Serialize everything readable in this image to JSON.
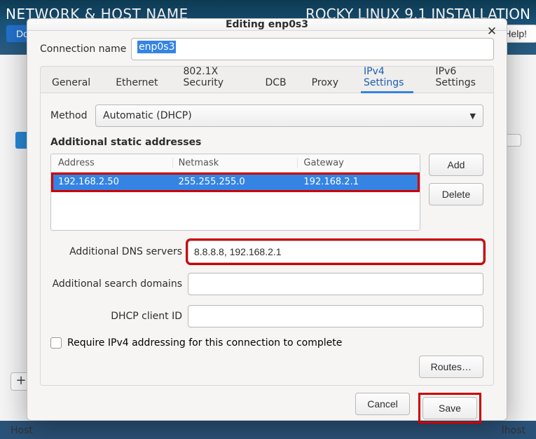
{
  "window": {
    "page_title": "NETWORK & HOST NAME",
    "installer_banner": "ROCKY LINUX 9.1 INSTALLATION",
    "done_btn": "Done",
    "help_btn": "Help!"
  },
  "background": {
    "hostname_label": "Host",
    "hostname_value": "lhost",
    "add_btn": "+"
  },
  "dialog": {
    "title": "Editing enp0s3",
    "close_glyph": "✕",
    "connection_name_label": "Connection name",
    "connection_name_value": "enp0s3",
    "tabs": {
      "general": "General",
      "ethernet": "Ethernet",
      "security": "802.1X Security",
      "dcb": "DCB",
      "proxy": "Proxy",
      "ipv4": "IPv4 Settings",
      "ipv6": "IPv6 Settings"
    },
    "method_label": "Method",
    "method_value": "Automatic (DHCP)",
    "addresses_heading": "Additional static addresses",
    "table": {
      "col_address": "Address",
      "col_netmask": "Netmask",
      "col_gateway": "Gateway",
      "rows": [
        {
          "address": "192.168.2.50",
          "netmask": "255.255.255.0",
          "gateway": "192.168.2.1"
        }
      ]
    },
    "add_btn": "Add",
    "delete_btn": "Delete",
    "dns_label": "Additional DNS servers",
    "dns_value": "8.8.8.8, 192.168.2.1",
    "search_label": "Additional search domains",
    "search_value": "",
    "dhcp_id_label": "DHCP client ID",
    "dhcp_id_value": "",
    "require_ipv4_label": "Require IPv4 addressing for this connection to complete",
    "routes_btn": "Routes…",
    "cancel_btn": "Cancel",
    "save_btn": "Save"
  }
}
